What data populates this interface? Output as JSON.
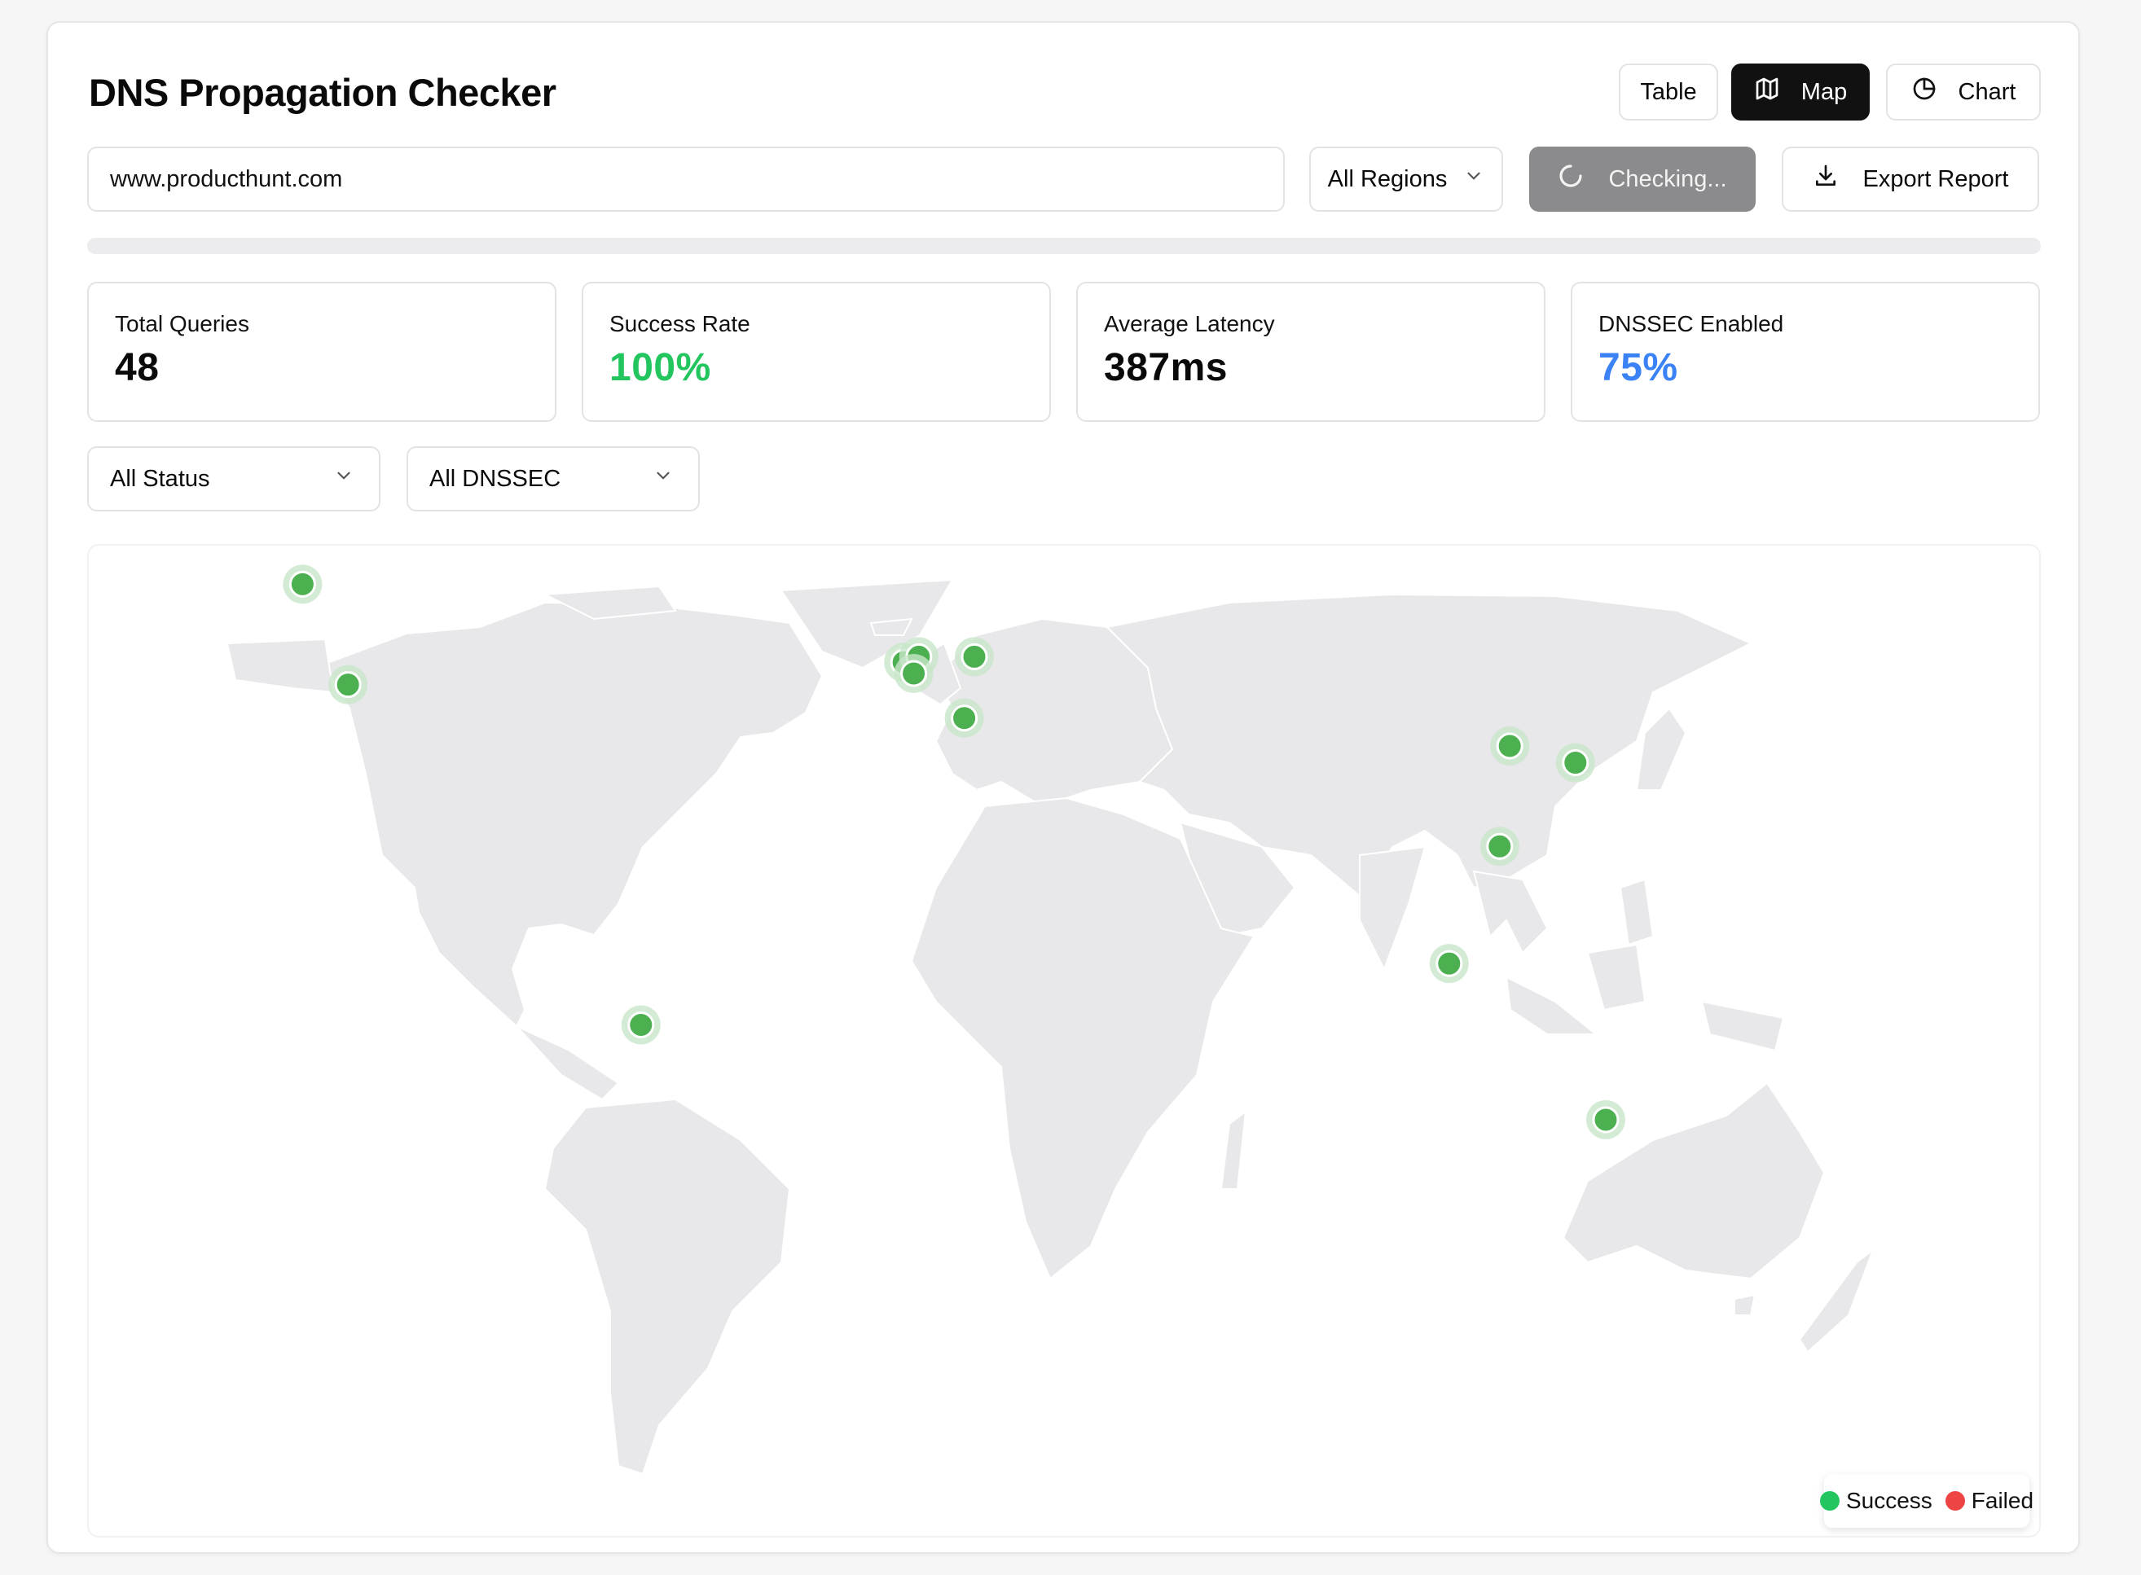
{
  "app": {
    "title": "DNS Propagation Checker"
  },
  "view_switch": {
    "table_label": "Table",
    "map_label": "Map",
    "chart_label": "Chart",
    "active": "Map"
  },
  "query": {
    "domain_value": "www.producthunt.com",
    "region_selected": "All Regions",
    "check_label": "Checking...",
    "export_label": "Export Report",
    "progress": 0
  },
  "stats": [
    {
      "label": "Total Queries",
      "value": "48",
      "color": "#0a0a0a"
    },
    {
      "label": "Success Rate",
      "value": "100%",
      "color": "#22c55e"
    },
    {
      "label": "Average Latency",
      "value": "387ms",
      "color": "#0a0a0a"
    },
    {
      "label": "DNSSEC Enabled",
      "value": "75%",
      "color": "#3b82f6"
    }
  ],
  "filters": {
    "status_selected": "All Status",
    "dnssec_selected": "All DNSSEC"
  },
  "map": {
    "land_color": "#e8e8ea",
    "border_color": "#ffffff",
    "servers": [
      {
        "lat": 69,
        "lon": -123,
        "status": "success"
      },
      {
        "lat": 51,
        "lon": -114,
        "status": "success"
      },
      {
        "lat": 55,
        "lon": -4,
        "status": "success"
      },
      {
        "lat": 56,
        "lon": -1,
        "status": "success"
      },
      {
        "lat": 53,
        "lon": -2,
        "status": "success"
      },
      {
        "lat": 56,
        "lon": 10,
        "status": "success"
      },
      {
        "lat": 45,
        "lon": 8,
        "status": "success"
      },
      {
        "lat": 40,
        "lon": 116,
        "status": "success"
      },
      {
        "lat": 37,
        "lon": 129,
        "status": "success"
      },
      {
        "lat": 22,
        "lon": 114,
        "status": "success"
      },
      {
        "lat": 1,
        "lon": 104,
        "status": "success"
      },
      {
        "lat": -10,
        "lon": -56,
        "status": "success"
      },
      {
        "lat": -27,
        "lon": 135,
        "status": "success"
      }
    ],
    "legend": [
      {
        "label": "Success",
        "color": "#22c55e"
      },
      {
        "label": "Failed",
        "color": "#ef4444"
      }
    ]
  }
}
